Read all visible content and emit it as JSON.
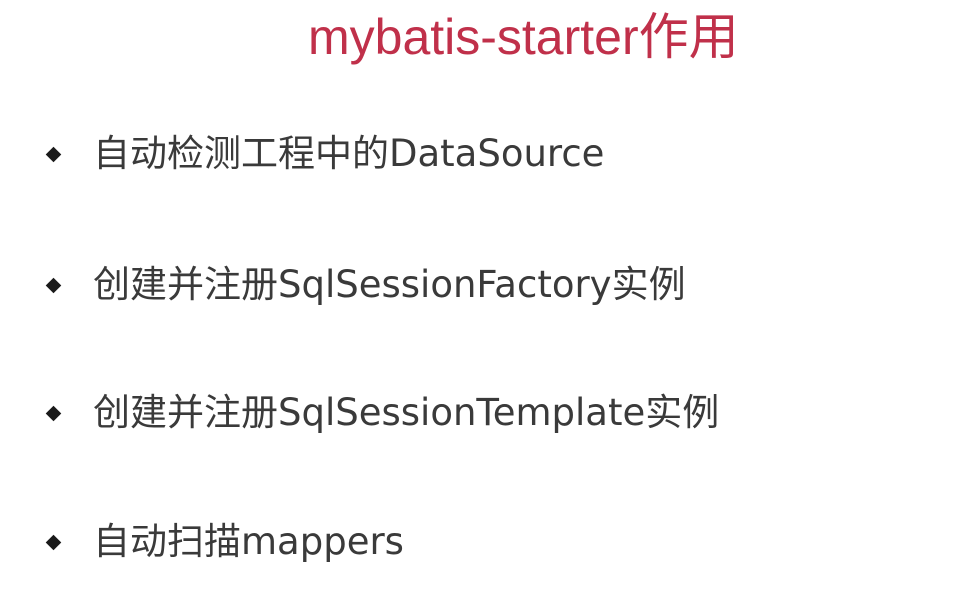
{
  "slide": {
    "title": "mybatis-starter作用",
    "title_color": "#c0304a",
    "bullet_icon": "diamond-bullet-icon",
    "bullets": [
      {
        "text": "自动检测工程中的DataSource"
      },
      {
        "text": "创建并注册SqlSessionFactory实例"
      },
      {
        "text": "创建并注册SqlSessionTemplate实例"
      },
      {
        "text": "自动扫描mappers"
      }
    ]
  }
}
